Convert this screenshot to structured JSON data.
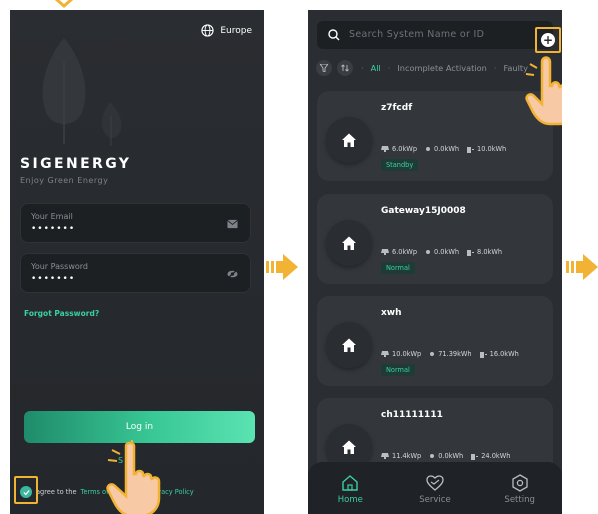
{
  "login": {
    "region": "Europe",
    "brand": "SIGENERGY",
    "tagline": "Enjoy Green Energy",
    "email_label": "Your Email",
    "email_value": "•••••••",
    "password_label": "Your Password",
    "password_value": "•••••••",
    "forgot": "Forgot Password?",
    "login_button": "Log in",
    "signup": "S",
    "agree_prefix": "agree to the",
    "terms": "Terms of Se",
    "privacy": "Privacy Policy"
  },
  "list": {
    "search_placeholder": "Search System Name or ID",
    "plus": "+",
    "filters": [
      "All",
      "Incomplete Activation",
      "Faulty"
    ],
    "nav": [
      {
        "label": "Home",
        "icon": "home-icon"
      },
      {
        "label": "Service",
        "icon": "service-icon"
      },
      {
        "label": "Setting",
        "icon": "setting-icon"
      }
    ],
    "systems": [
      {
        "name": "z7fcdf",
        "pv": "6.0kWp",
        "energy": "0.0kWh",
        "battery": "10.0kWh",
        "status": "Standby",
        "more": "..."
      },
      {
        "name": "Gateway15J0008",
        "pv": "6.0kWp",
        "energy": "0.0kWh",
        "battery": "8.0kWh",
        "status": "Normal"
      },
      {
        "name": "xwh",
        "pv": "10.0kWp",
        "energy": "71.39kWh",
        "battery": "16.0kWh",
        "status": "Normal"
      },
      {
        "name": "ch11111111",
        "pv": "11.4kWp",
        "energy": "0.0kWh",
        "battery": "24.0kWh"
      }
    ]
  },
  "colors": {
    "accent": "#3ad0a0",
    "highlight": "#f2b233",
    "background": "#2a2d31",
    "card": "#33373c"
  }
}
